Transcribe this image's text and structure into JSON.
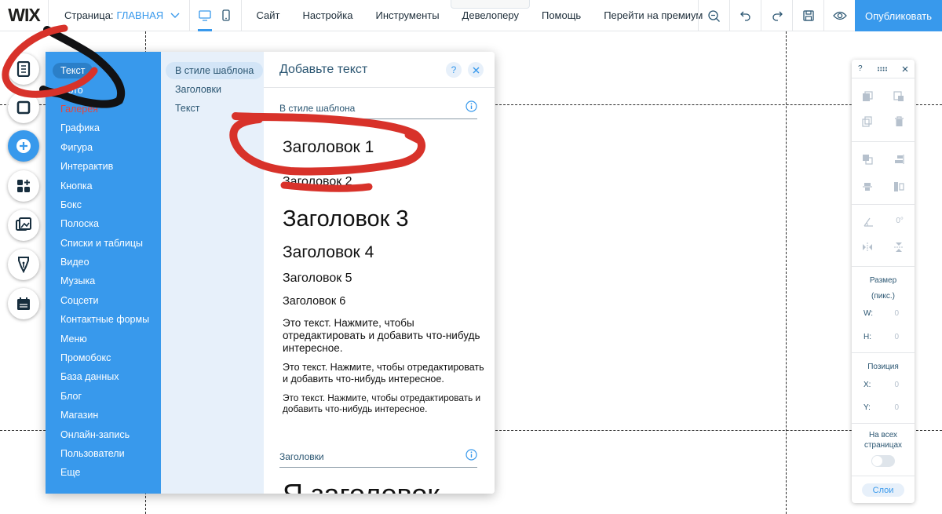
{
  "topbar": {
    "logo": "WIX",
    "page_prefix": "Страница:",
    "page_name": "ГЛАВНАЯ",
    "menu": [
      "Сайт",
      "Настройка",
      "Инструменты",
      "Девелоперу",
      "Помощь",
      "Перейти на премиум"
    ],
    "publish": "Опубликовать"
  },
  "rail": {
    "icons": [
      "pages-icon",
      "background-icon",
      "add-icon",
      "apps-icon",
      "media-icon",
      "blog-pen-icon",
      "bookings-icon"
    ]
  },
  "add_panel": {
    "categories": [
      "Текст",
      "Фото",
      "Галерея",
      "Графика",
      "Фигура",
      "Интерактив",
      "Кнопка",
      "Бокс",
      "Полоска",
      "Списки и таблицы",
      "Видео",
      "Музыка",
      "Соцсети",
      "Контактные формы",
      "Меню",
      "Промобокс",
      "База данных",
      "Блог",
      "Магазин",
      "Онлайн-запись",
      "Пользователи",
      "Еще"
    ],
    "selected_category": "Текст",
    "subcategories": [
      "В стиле шаблона",
      "Заголовки",
      "Текст"
    ],
    "title": "Добавьте текст",
    "help": "?",
    "section1": "В стиле шаблона",
    "headings": [
      "Заголовок 1",
      "Заголовок 2",
      "Заголовок 3",
      "Заголовок 4",
      "Заголовок 5",
      "Заголовок 6"
    ],
    "paragraphs": [
      "Это текст. Нажмите, чтобы отредактировать и добавить что-нибудь интересное.",
      "Это текст. Нажмите, чтобы отредактировать и добавить что-нибудь интересное.",
      "Это текст. Нажмите, чтобы отредактировать и добавить что-нибудь интересное."
    ],
    "section2": "Заголовки",
    "big_heading": "Я заголовок"
  },
  "toolbox": {
    "help": "?",
    "size_label": "Размер",
    "size_unit": "(пикс.)",
    "w_label": "W:",
    "w_value": "0",
    "h_label": "H:",
    "h_value": "0",
    "position_label": "Позиция",
    "x_label": "X:",
    "x_value": "0",
    "y_label": "Y:",
    "y_value": "0",
    "angle_value": "0°",
    "all_pages": "На всех страницах",
    "layers": "Слои"
  },
  "colors": {
    "accent": "#3899ec",
    "panel_blue": "#3899ec",
    "sub_panel": "#e7f0fa",
    "annotation_red": "#d8322a"
  }
}
